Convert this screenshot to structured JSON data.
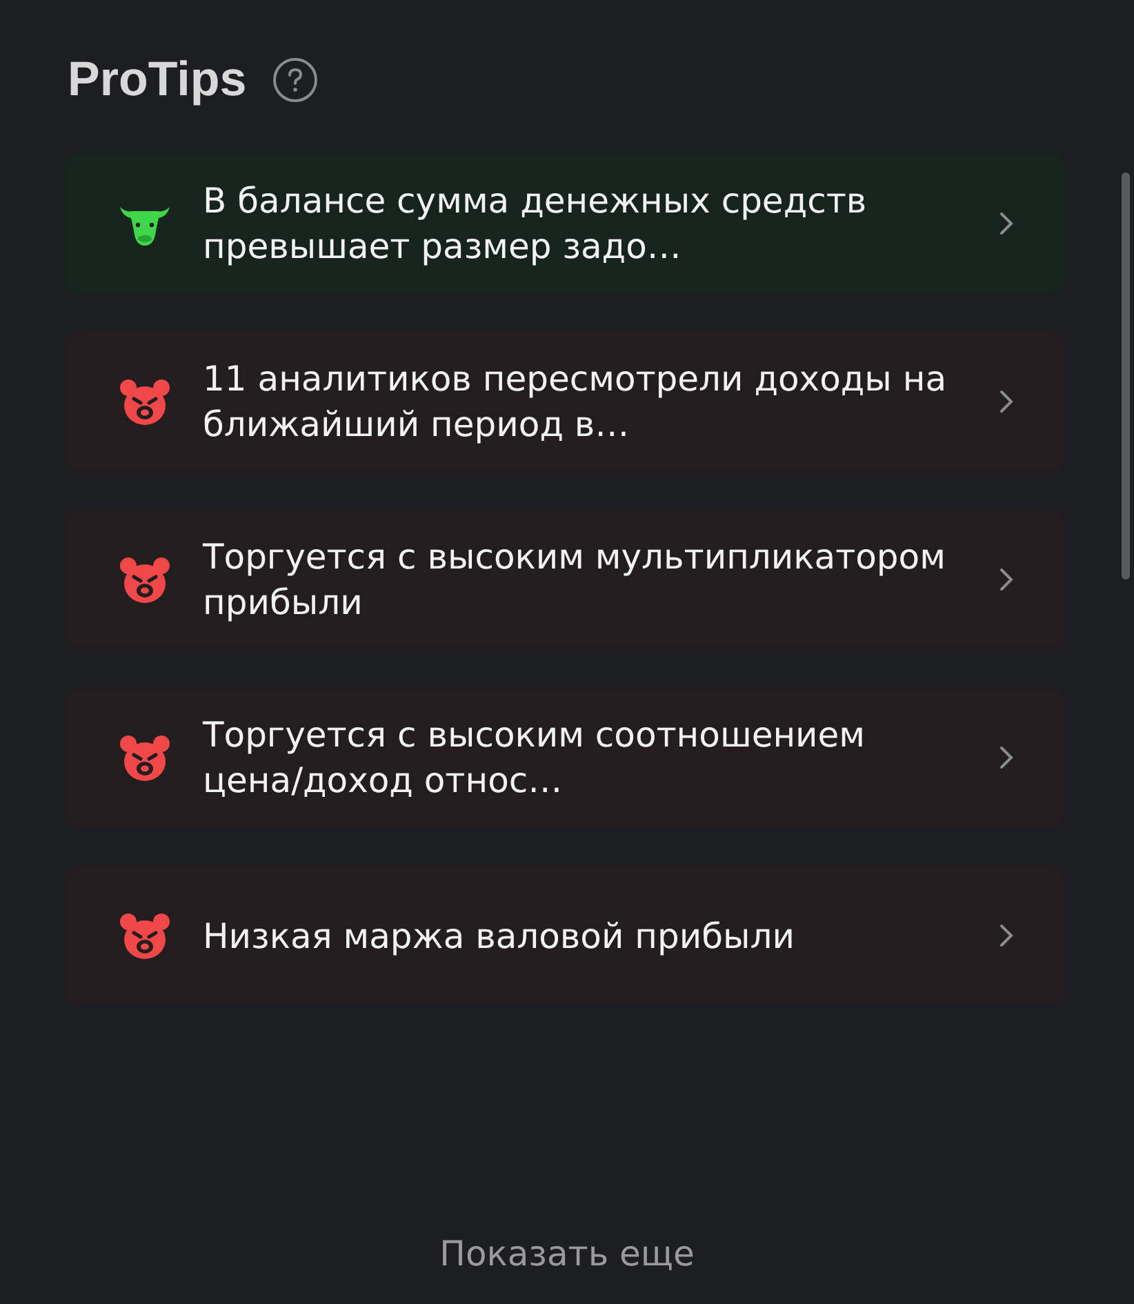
{
  "title": "ProTips",
  "tips": [
    {
      "kind": "bull",
      "text": "В балансе сумма денежных средств превышает размер задо…"
    },
    {
      "kind": "bear",
      "text": "11 аналитиков пересмотрели доходы на ближайший период в…"
    },
    {
      "kind": "bear",
      "text": "Торгуется с высоким мультипликатором прибыли"
    },
    {
      "kind": "bear",
      "text": "Торгуется с высоким соотношением цена/доход относ…"
    },
    {
      "kind": "bear",
      "text": "Низкая маржа валовой прибыли"
    }
  ],
  "show_more": "Показать еще"
}
